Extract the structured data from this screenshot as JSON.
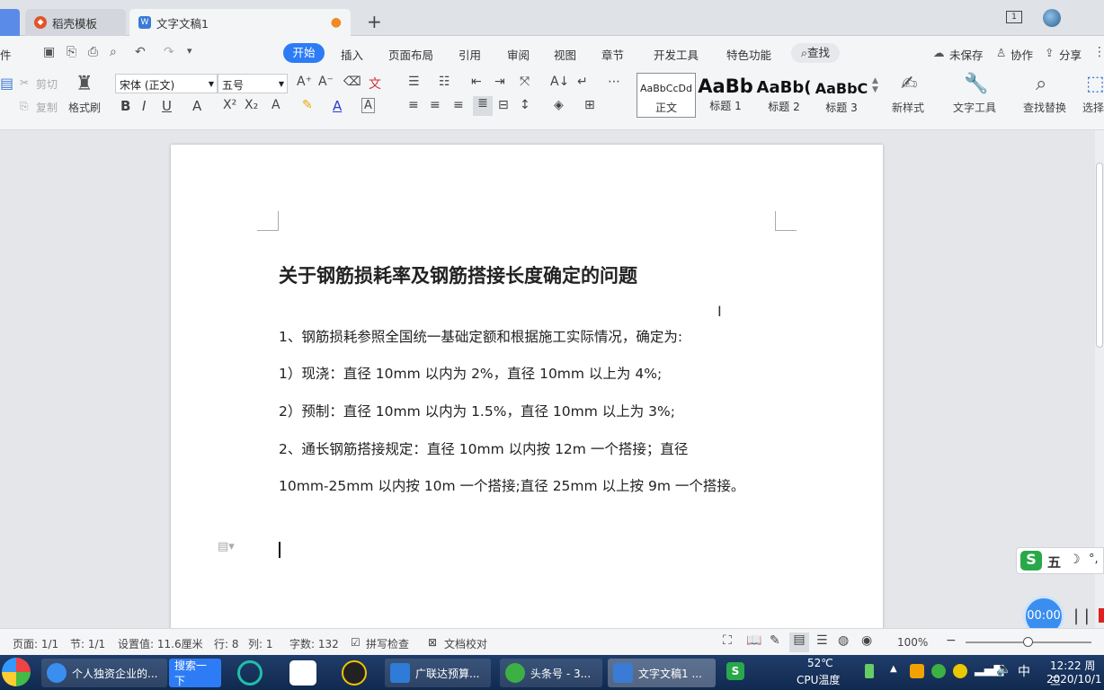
{
  "tabs": [
    {
      "label": "稻壳模板"
    },
    {
      "label": "文字文稿1"
    }
  ],
  "menu": {
    "left": "件",
    "items": [
      "开始",
      "插入",
      "页面布局",
      "引用",
      "审阅",
      "视图",
      "章节",
      "开发工具",
      "特色功能"
    ],
    "search": "查找",
    "unsaved": "未保存",
    "collab": "协作",
    "share": "分享"
  },
  "ribbon": {
    "cut": "剪切",
    "copy": "复制",
    "painter": "格式刷",
    "font": "宋体 (正文)",
    "size": "五号",
    "styles": [
      {
        "preview": "AaBbCcDd",
        "name": "正文"
      },
      {
        "preview": "AaBb",
        "name": "标题 1"
      },
      {
        "preview": "AaBb(",
        "name": "标题 2"
      },
      {
        "preview": "AaBbC",
        "name": "标题 3"
      }
    ],
    "new_style": "新样式",
    "text_tools": "文字工具",
    "find_replace": "查找替换",
    "select": "选择"
  },
  "document": {
    "title": "关于钢筋损耗率及钢筋搭接长度确定的问题",
    "lines": [
      "1、钢筋损耗参照全国统一基础定额和根据施工实际情况，确定为:",
      "1）现浇：直径 10mm 以内为 2%，直径 10mm 以上为 4%;",
      "2）预制：直径 10mm 以内为 1.5%，直径 10mm 以上为 3%;",
      "2、通长钢筋搭接规定：直径 10mm 以内按 12m 一个搭接；直径",
      "10mm-25mm 以内按 10m 一个搭接;直径 25mm 以上按 9m 一个搭接。"
    ]
  },
  "ime": {
    "label": "五",
    "timer": "00:00"
  },
  "status": {
    "page": "页面: 1/1",
    "section": "节: 1/1",
    "setting": "设置值: 11.6厘米",
    "row": "行: 8",
    "col": "列: 1",
    "words": "字数: 132",
    "spell": "拼写检查",
    "proof": "文档校对",
    "zoom": "100%"
  },
  "taskbar": {
    "ie": "个人独资企业的...",
    "search": "搜索一下",
    "yu": "广联达预算...",
    "toutiao": "头条号 - 3...",
    "wps": "文字文稿1 ...",
    "temp": "52℃",
    "cpu": "CPU温度",
    "time": "12:22 周三",
    "date": "2020/10/1"
  }
}
